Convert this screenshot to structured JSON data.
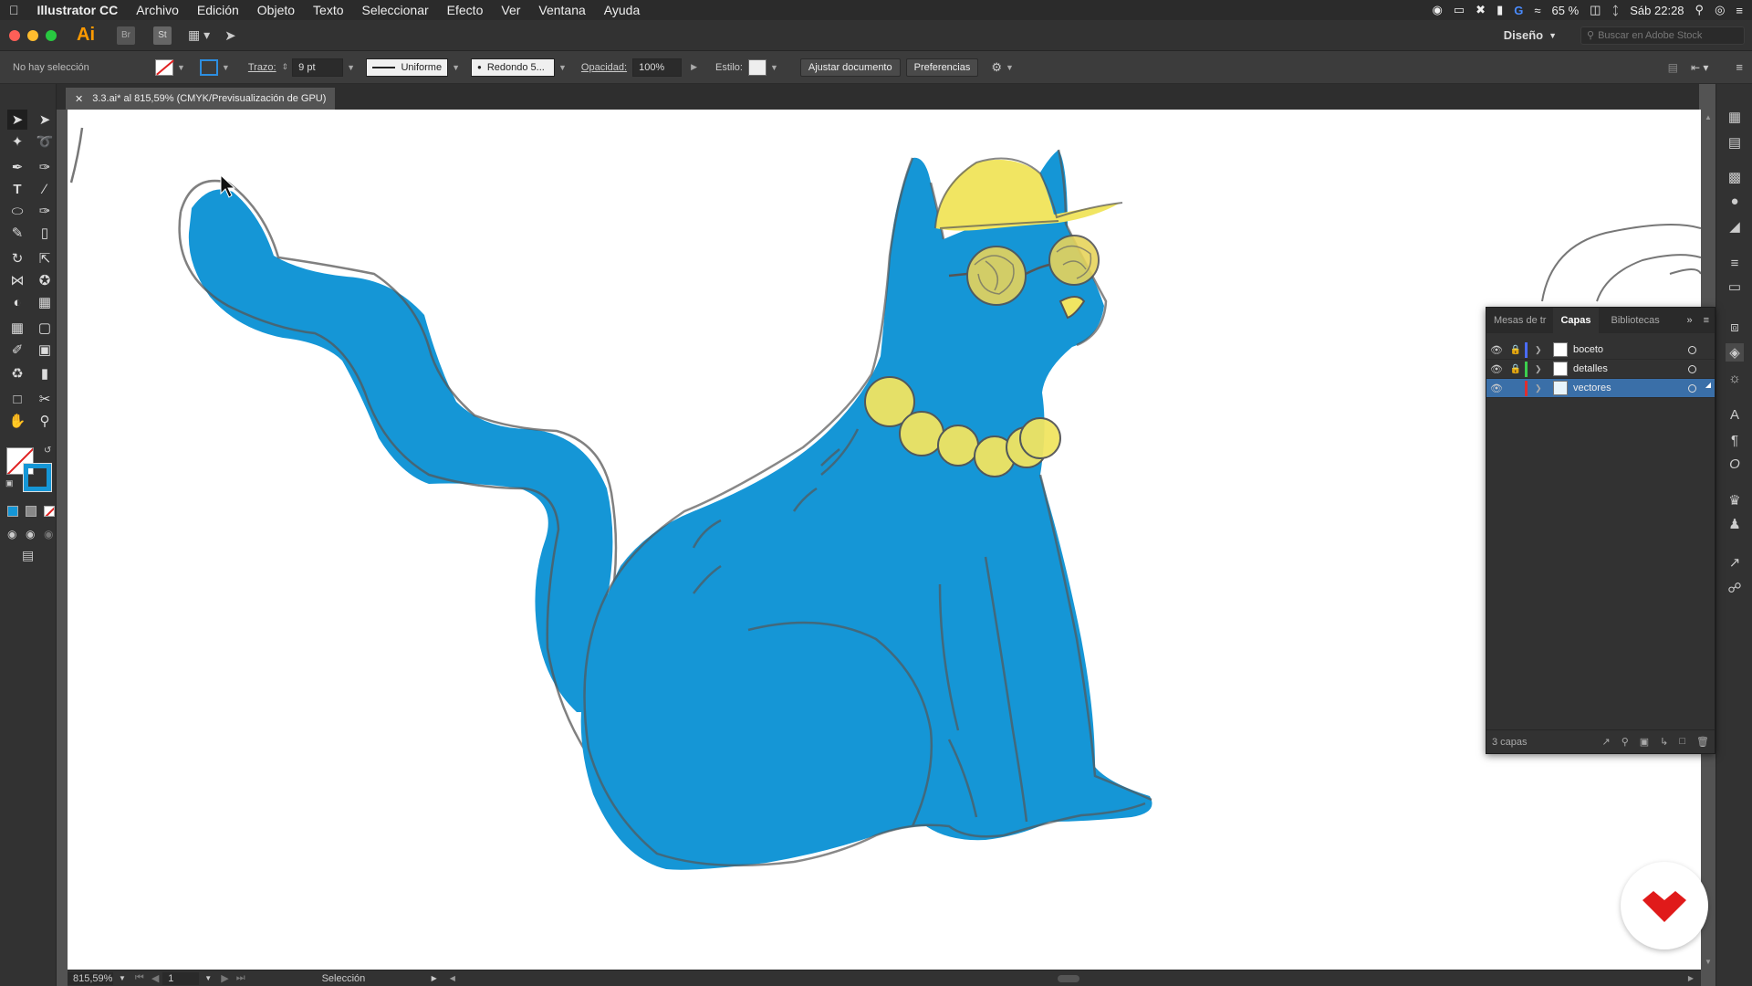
{
  "menubar": {
    "app_name": "Illustrator CC",
    "items": [
      "Archivo",
      "Edición",
      "Objeto",
      "Texto",
      "Seleccionar",
      "Efecto",
      "Ver",
      "Ventana",
      "Ayuda"
    ],
    "battery": "65 %",
    "clock": "Sáb 22:28"
  },
  "appbar": {
    "logo": "Ai",
    "bridge": "Br",
    "stock": "St",
    "workspace": "Diseño",
    "stock_search_placeholder": "Buscar en Adobe Stock"
  },
  "control": {
    "selection": "No hay selección",
    "trazo_label": "Trazo:",
    "trazo_value": "9 pt",
    "profile": "Uniforme",
    "brush": "Redondo 5...",
    "opacity_label": "Opacidad:",
    "opacity_value": "100%",
    "style_label": "Estilo:",
    "btn_document": "Ajustar documento",
    "btn_prefs": "Preferencias"
  },
  "document": {
    "tab_title": "3.3.ai* al 815,59% (CMYK/Previsualización de GPU)"
  },
  "layers_panel": {
    "tabs": [
      "Mesas de tr",
      "Capas",
      "Bibliotecas"
    ],
    "active_tab": "Capas",
    "layers": [
      {
        "name": "boceto",
        "color": "#4a6cff",
        "locked": true,
        "selected": false
      },
      {
        "name": "detalles",
        "color": "#3ccf4e",
        "locked": true,
        "selected": false
      },
      {
        "name": "vectores",
        "color": "#e02f2f",
        "locked": false,
        "selected": true
      }
    ],
    "footer": "3 capas"
  },
  "status": {
    "zoom": "815,59%",
    "artboard": "1",
    "tool": "Selección"
  },
  "colors": {
    "cat_fill": "#1596d6",
    "accessory_fill": "#f1e562",
    "sketch_stroke": "#555555"
  }
}
